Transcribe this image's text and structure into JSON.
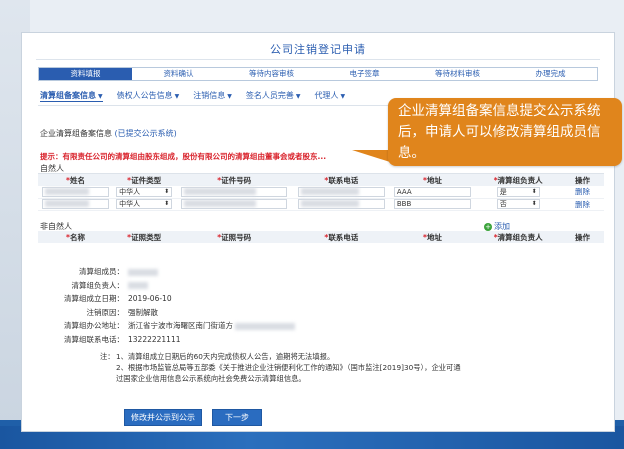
{
  "window": {
    "title": "公司注销登记申请"
  },
  "steps": [
    "资料填报",
    "资料确认",
    "等待内容审核",
    "电子签章",
    "等待材料审核",
    "办理完成"
  ],
  "active_step": 0,
  "subtabs": [
    {
      "label": "清算组备案信息",
      "active": true
    },
    {
      "label": "债权人公告信息",
      "active": false
    },
    {
      "label": "注销信息",
      "active": false
    },
    {
      "label": "签名人员完善",
      "active": false
    },
    {
      "label": "代理人",
      "active": false
    }
  ],
  "section": {
    "title": "企业清算组备案信息",
    "link": "(已提交公示系统)"
  },
  "hint": "提示：有限责任公司的清算组由股东组成，股份有限公司的清算组由董事会或者股东...",
  "natural": {
    "group_label": "自然人",
    "headers": [
      "*姓名",
      "*证件类型",
      "*证件号码",
      "*联系电话",
      "*地址",
      "*清算组负责人",
      "操作"
    ],
    "rows": [
      {
        "doc_type": "中华人",
        "address": "AAA",
        "leader": "是",
        "action": "删除"
      },
      {
        "doc_type": "中华人",
        "address": "BBB",
        "leader": "否",
        "action": "删除"
      }
    ]
  },
  "non_natural": {
    "group_label": "非自然人",
    "add_label": "添加",
    "headers": [
      "*名称",
      "*证照类型",
      "*证照号码",
      "*联系电话",
      "*地址",
      "*清算组负责人",
      "操作"
    ]
  },
  "info": {
    "members_label": "清算组成员：",
    "leader_label": "清算组负责人：",
    "date_label": "清算组成立日期：",
    "date_value": "2019-06-10",
    "reason_label": "注销原因：",
    "reason_value": "强制解散",
    "address_label": "清算组办公地址：",
    "address_value": "浙江省宁波市海曙区南门街道方",
    "phone_label": "清算组联系电话：",
    "phone_value": "13222221111",
    "notes_label": "注：",
    "note1": "1、清算组成立日期后的60天内完成债权人公告，逾期将无法填报。",
    "note2": "2、根据市场监管总局等五部委《关于推进企业注销便利化工作的通知》（国市监注[2019]30号），企业可通过国家企业信用信息公示系统向社会免费公示清算组信息。"
  },
  "buttons": {
    "modify": "修改并公示到公示",
    "next": "下一步"
  },
  "callout": {
    "text": "企业清算组备案信息提交公示系统后，申请人可以修改清算组成员信息。"
  },
  "colors": {
    "accent": "#2a5db0",
    "callout": "#e0851c",
    "warning": "#d9232c"
  }
}
